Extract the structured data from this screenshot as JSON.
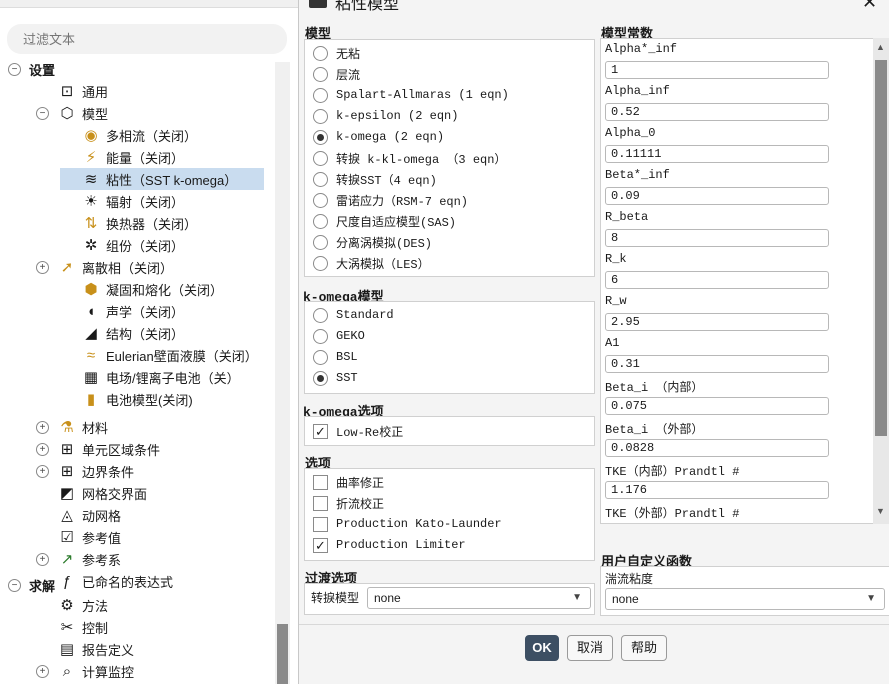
{
  "search": {
    "placeholder": "过滤文本"
  },
  "tree": [
    {
      "label": "设置",
      "icon": "setup-icon",
      "expander": "−",
      "bold": true
    },
    {
      "label": "通用",
      "icon": "general-icon",
      "expander": ""
    },
    {
      "label": "模型",
      "icon": "models-icon",
      "expander": "−"
    },
    {
      "label": "多相流（关闭）",
      "icon": "multiphase-icon",
      "expander": ""
    },
    {
      "label": "能量（关闭）",
      "icon": "energy-icon",
      "expander": ""
    },
    {
      "label": "粘性（SST k-omega）",
      "icon": "viscous-icon",
      "expander": "",
      "selected": true
    },
    {
      "label": "辐射（关闭）",
      "icon": "radiation-icon",
      "expander": ""
    },
    {
      "label": "换热器（关闭）",
      "icon": "heat-exchanger-icon",
      "expander": ""
    },
    {
      "label": "组份（关闭）",
      "icon": "species-icon",
      "expander": ""
    },
    {
      "label": "离散相（关闭）",
      "icon": "discrete-phase-icon",
      "expander": "+"
    },
    {
      "label": "凝固和熔化（关闭）",
      "icon": "solidification-icon",
      "expander": ""
    },
    {
      "label": "声学（关闭）",
      "icon": "acoustics-icon",
      "expander": ""
    },
    {
      "label": "结构（关闭）",
      "icon": "structure-icon",
      "expander": ""
    },
    {
      "label": "Eulerian壁面液膜（关闭）",
      "icon": "wall-film-icon",
      "expander": ""
    },
    {
      "label": "电场/锂离子电池（关）",
      "icon": "potential-icon",
      "expander": ""
    },
    {
      "label": "电池模型(关闭)",
      "icon": "battery-icon",
      "expander": ""
    },
    {
      "label": "材料",
      "icon": "materials-icon",
      "expander": "+"
    },
    {
      "label": "单元区域条件",
      "icon": "cell-zone-icon",
      "expander": "+"
    },
    {
      "label": "边界条件",
      "icon": "boundary-icon",
      "expander": "+"
    },
    {
      "label": "网格交界面",
      "icon": "mesh-interface-icon",
      "expander": ""
    },
    {
      "label": "动网格",
      "icon": "dynamic-mesh-icon",
      "expander": ""
    },
    {
      "label": "参考值",
      "icon": "reference-values-icon",
      "expander": ""
    },
    {
      "label": "参考系",
      "icon": "reference-frames-icon",
      "expander": "+"
    },
    {
      "label": "已命名的表达式",
      "icon": "named-expressions-icon",
      "expander": ""
    },
    {
      "label": "求解",
      "icon": "solution-icon",
      "expander": "−",
      "bold": true
    },
    {
      "label": "方法",
      "icon": "methods-icon",
      "expander": ""
    },
    {
      "label": "控制",
      "icon": "controls-icon",
      "expander": ""
    },
    {
      "label": "报告定义",
      "icon": "report-definitions-icon",
      "expander": ""
    },
    {
      "label": "计算监控",
      "icon": "monitors-icon",
      "expander": "+"
    }
  ],
  "dialog": {
    "title": "粘性模型",
    "model_label": "模型",
    "models": [
      {
        "label": "无粘",
        "checked": false
      },
      {
        "label": "层流",
        "checked": false
      },
      {
        "label": "Spalart-Allmaras (1 eqn)",
        "checked": false
      },
      {
        "label": "k-epsilon (2 eqn)",
        "checked": false
      },
      {
        "label": "k-omega (2 eqn)",
        "checked": true
      },
      {
        "label": "转捩 k-kl-omega （3 eqn）",
        "checked": false
      },
      {
        "label": "转捩SST（4 eqn)",
        "checked": false
      },
      {
        "label": "雷诺应力（RSM-7 eqn)",
        "checked": false
      },
      {
        "label": "尺度自适应模型(SAS)",
        "checked": false
      },
      {
        "label": "分离涡模拟(DES)",
        "checked": false
      },
      {
        "label": "大涡模拟（LES）",
        "checked": false
      }
    ],
    "komega_model_label": "k-omega模型",
    "komega_models": [
      {
        "label": "Standard",
        "checked": false
      },
      {
        "label": "GEKO",
        "checked": false
      },
      {
        "label": "BSL",
        "checked": false
      },
      {
        "label": "SST",
        "checked": true
      }
    ],
    "komega_options_label": "k-omega选项",
    "komega_options": [
      {
        "label": "Low-Re校正",
        "checked": true
      }
    ],
    "options_label": "选项",
    "options": [
      {
        "label": "曲率修正",
        "checked": false
      },
      {
        "label": "折流校正",
        "checked": false
      },
      {
        "label": "Production Kato-Launder",
        "checked": false
      },
      {
        "label": "Production Limiter",
        "checked": true
      }
    ],
    "transition_label": "过渡选项",
    "transition_model_label": "转捩模型",
    "transition_model_value": "none",
    "constants_label": "模型常数",
    "constants": [
      {
        "name": "Alpha*_inf",
        "value": "1"
      },
      {
        "name": "Alpha_inf",
        "value": "0.52"
      },
      {
        "name": "Alpha_0",
        "value": "0.11111"
      },
      {
        "name": "Beta*_inf",
        "value": "0.09"
      },
      {
        "name": "R_beta",
        "value": "8"
      },
      {
        "name": "R_k",
        "value": "6"
      },
      {
        "name": "R_w",
        "value": "2.95"
      },
      {
        "name": "A1",
        "value": "0.31"
      },
      {
        "name": "Beta_i （内部）",
        "value": "0.075"
      },
      {
        "name": "Beta_i （外部）",
        "value": "0.0828"
      },
      {
        "name": "TKE（内部）Prandtl #",
        "value": "1.176"
      },
      {
        "name": "TKE（外部）Prandtl #",
        "value": ""
      }
    ],
    "udf_label": "用户自定义函数",
    "turb_visc_label": "湍流粘度",
    "turb_visc_value": "none",
    "buttons": {
      "ok": "OK",
      "cancel": "取消",
      "help": "帮助"
    },
    "close_glyph": "✕"
  }
}
